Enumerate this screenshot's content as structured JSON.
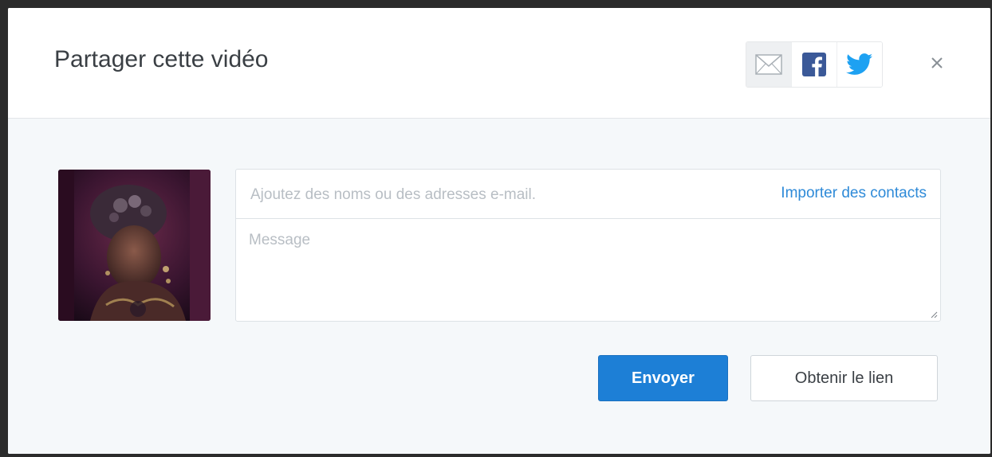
{
  "dialog": {
    "title": "Partager cette vidéo",
    "close_icon": "close-icon"
  },
  "share": {
    "items": [
      {
        "name": "email",
        "icon": "envelope-icon"
      },
      {
        "name": "facebook",
        "icon": "facebook-icon",
        "color": "#3b5998"
      },
      {
        "name": "twitter",
        "icon": "twitter-icon",
        "color": "#1da1f2"
      }
    ]
  },
  "form": {
    "recipients_placeholder": "Ajoutez des noms ou des adresses e-mail.",
    "recipients_value": "",
    "import_contacts_label": "Importer des contacts",
    "message_placeholder": "Message",
    "message_value": ""
  },
  "actions": {
    "send_label": "Envoyer",
    "get_link_label": "Obtenir le lien"
  },
  "colors": {
    "accent": "#1d7fd6",
    "link": "#2e8ad8",
    "body_bg": "#f5f8fa"
  }
}
